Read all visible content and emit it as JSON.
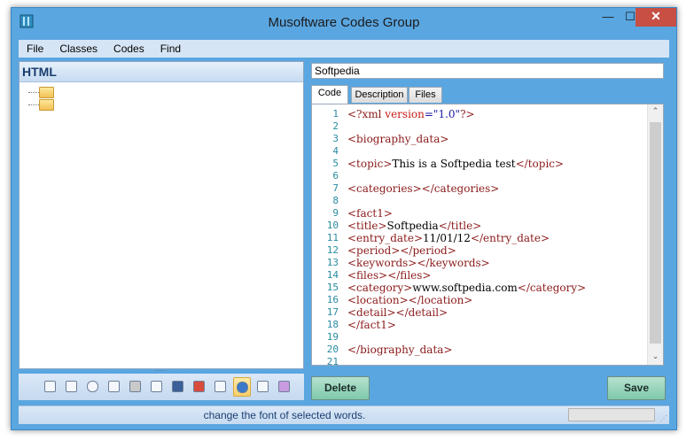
{
  "window": {
    "title": "Musoftware Codes Group",
    "minimize": "—",
    "maximize": "☐",
    "close": "✕"
  },
  "menu": [
    "File",
    "Classes",
    "Codes",
    "Find"
  ],
  "left_panel": {
    "header": "HTML",
    "splitter_grip": "·····"
  },
  "toolbar": {
    "icons": [
      "new-doc-icon",
      "edit-icon",
      "php-icon",
      "cpp-icon",
      "database-icon",
      "csharp-icon",
      "css-icon",
      "flash-icon",
      "java-icon",
      "html-icon",
      "vb-icon",
      "xml-icon"
    ],
    "active": "html-icon"
  },
  "editor": {
    "name_value": "Softpedia",
    "tabs": [
      "Code",
      "Description",
      "Files"
    ],
    "active_tab": "Code",
    "line_numbers": [
      "1",
      "2",
      "3",
      "4",
      "5",
      "6",
      "7",
      "8",
      "9",
      "10",
      "11",
      "12",
      "13",
      "14",
      "15",
      "16",
      "17",
      "18",
      "19",
      "20",
      "21"
    ],
    "lines": [
      [
        [
          "<?xml ",
          "#8b1a1a"
        ],
        [
          "version",
          "#c41a16"
        ],
        [
          "=\"1.0\"",
          "#1a1aa6"
        ],
        [
          "?>",
          "#8b1a1a"
        ]
      ],
      [],
      [
        [
          "<biography_data>",
          "#8b1a1a"
        ]
      ],
      [],
      [
        [
          "<topic>",
          "#8b1a1a"
        ],
        [
          "This is a Softpedia test",
          "#000000"
        ],
        [
          "</topic>",
          "#8b1a1a"
        ]
      ],
      [],
      [
        [
          "<categories></categories>",
          "#8b1a1a"
        ]
      ],
      [],
      [
        [
          "<fact1>",
          "#8b1a1a"
        ]
      ],
      [
        [
          "<title>",
          "#8b1a1a"
        ],
        [
          "Softpedia",
          "#000000"
        ],
        [
          "</title>",
          "#8b1a1a"
        ]
      ],
      [
        [
          "<entry_date>",
          "#8b1a1a"
        ],
        [
          "11/01/12",
          "#000000"
        ],
        [
          "</entry_date>",
          "#8b1a1a"
        ]
      ],
      [
        [
          "<period></period>",
          "#8b1a1a"
        ]
      ],
      [
        [
          "<keywords></keywords>",
          "#8b1a1a"
        ]
      ],
      [
        [
          "<files></files>",
          "#8b1a1a"
        ]
      ],
      [
        [
          "<category>",
          "#8b1a1a"
        ],
        [
          "www.softpedia.com",
          "#000000"
        ],
        [
          "</category>",
          "#8b1a1a"
        ]
      ],
      [
        [
          "<location></location>",
          "#8b1a1a"
        ]
      ],
      [
        [
          "<detail></detail>",
          "#8b1a1a"
        ]
      ],
      [
        [
          "</fact1>",
          "#8b1a1a"
        ]
      ],
      [],
      [
        [
          "</biography_data>",
          "#8b1a1a"
        ]
      ],
      []
    ],
    "scroll_up": "⌃",
    "scroll_down": "⌄"
  },
  "buttons": {
    "delete": "Delete",
    "save": "Save"
  },
  "status": {
    "text": "change the font of selected words.",
    "grip": "⋰"
  },
  "colors": {
    "frame": "#5aa6e0",
    "button": "#8fd0b7",
    "close": "#c74f43"
  }
}
